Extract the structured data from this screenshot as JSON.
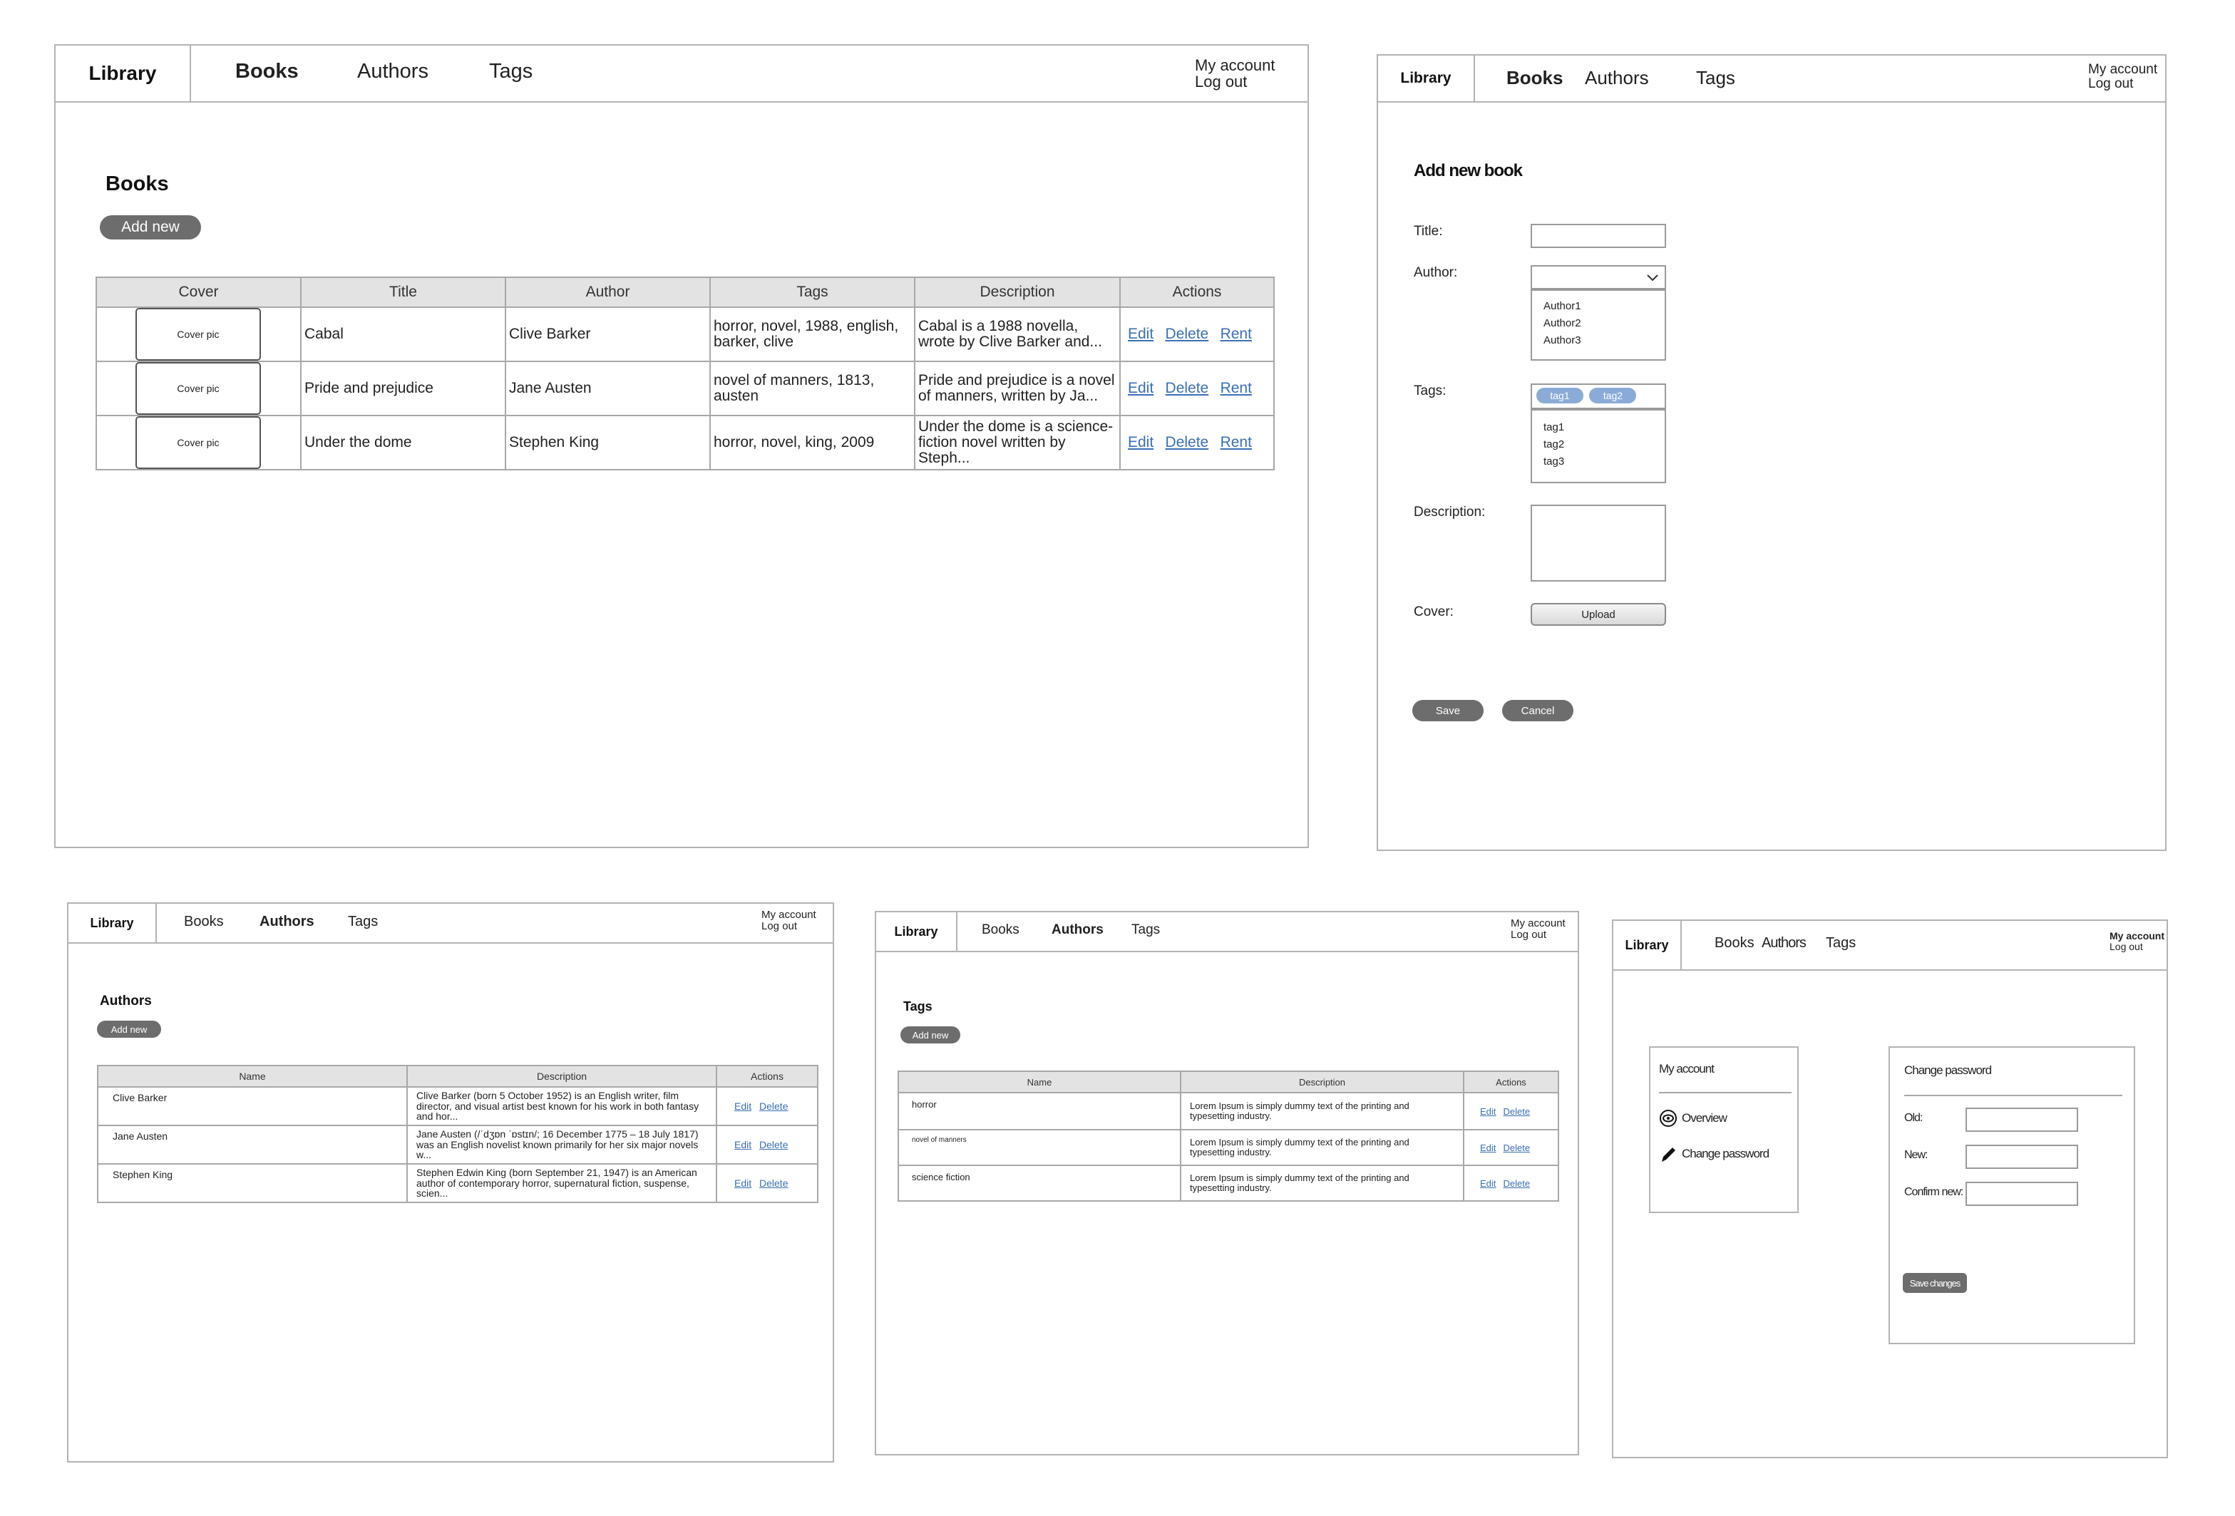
{
  "nav": {
    "brand": "Library",
    "books": "Books",
    "authors": "Authors",
    "tags": "Tags",
    "my_account": "My account",
    "log_out": "Log out"
  },
  "books_page": {
    "heading": "Books",
    "add_new": "Add new",
    "columns": [
      "Cover",
      "Title",
      "Author",
      "Tags",
      "Description",
      "Actions"
    ],
    "cover_placeholder": "Cover pic",
    "actions": {
      "edit": "Edit",
      "delete": "Delete",
      "rent": "Rent"
    },
    "rows": [
      {
        "title": "Cabal",
        "author": "Clive Barker",
        "tags": "horror, novel, 1988, english, barker, clive",
        "description": "Cabal is a 1988 novella, wrote by Clive Barker and..."
      },
      {
        "title": "Pride and prejudice",
        "author": "Jane Austen",
        "tags": "novel of manners, 1813, austen",
        "description": "Pride and prejudice is a novel of manners, written by Ja..."
      },
      {
        "title": "Under the dome",
        "author": "Stephen King",
        "tags": "horror, novel, king, 2009",
        "description": "Under the dome is a science-fiction novel written by Steph..."
      }
    ]
  },
  "add_book_page": {
    "heading": "Add new book",
    "title_label": "Title:",
    "author_label": "Author:",
    "author_options": [
      "Author1",
      "Author2",
      "Author3"
    ],
    "tags_label": "Tags:",
    "selected_tags": [
      "tag1",
      "tag2"
    ],
    "tag_options": [
      "tag1",
      "tag2",
      "tag3"
    ],
    "description_label": "Description:",
    "cover_label": "Cover:",
    "upload": "Upload",
    "save": "Save",
    "cancel": "Cancel"
  },
  "authors_page": {
    "heading": "Authors",
    "add_new": "Add new",
    "columns": [
      "Name",
      "Description",
      "Actions"
    ],
    "actions": {
      "edit": "Edit",
      "delete": "Delete"
    },
    "rows": [
      {
        "name": "Clive Barker",
        "description": "Clive Barker (born 5 October 1952) is an English writer, film director, and visual artist best known for his work in both fantasy and hor..."
      },
      {
        "name": "Jane Austen",
        "description": "Jane Austen (/ˈdʒɒn ˈɒstɪn/; 16 December 1775 – 18 July 1817) was an English novelist known primarily for her six major novels w..."
      },
      {
        "name": "Stephen King",
        "description": "Stephen Edwin King (born September 21, 1947) is an American author of contemporary horror, supernatural fiction, suspense, scien..."
      }
    ]
  },
  "tags_page": {
    "heading": "Tags",
    "add_new": "Add new",
    "columns": [
      "Name",
      "Description",
      "Actions"
    ],
    "actions": {
      "edit": "Edit",
      "delete": "Delete"
    },
    "rows": [
      {
        "name": "horror",
        "description": "Lorem Ipsum is simply dummy text of the printing and typesetting industry."
      },
      {
        "name": "novel of manners",
        "description": "Lorem Ipsum is simply dummy text of the printing and typesetting industry."
      },
      {
        "name": "science fiction",
        "description": "Lorem Ipsum is simply dummy text of the printing and typesetting industry."
      }
    ]
  },
  "account_page": {
    "menu_title": "My account",
    "overview": "Overview",
    "change_password_menu": "Change password",
    "form_title": "Change password",
    "old_label": "Old:",
    "new_label": "New:",
    "confirm_label": "Confirm new:",
    "save_changes": "Save changes"
  },
  "colors": {
    "border": "#b3b3b3",
    "pill_button": "#6d6d6d",
    "link": "#3a6fb5",
    "tag_chip": "#8aabd8",
    "header_fill": "#e3e3e3"
  }
}
